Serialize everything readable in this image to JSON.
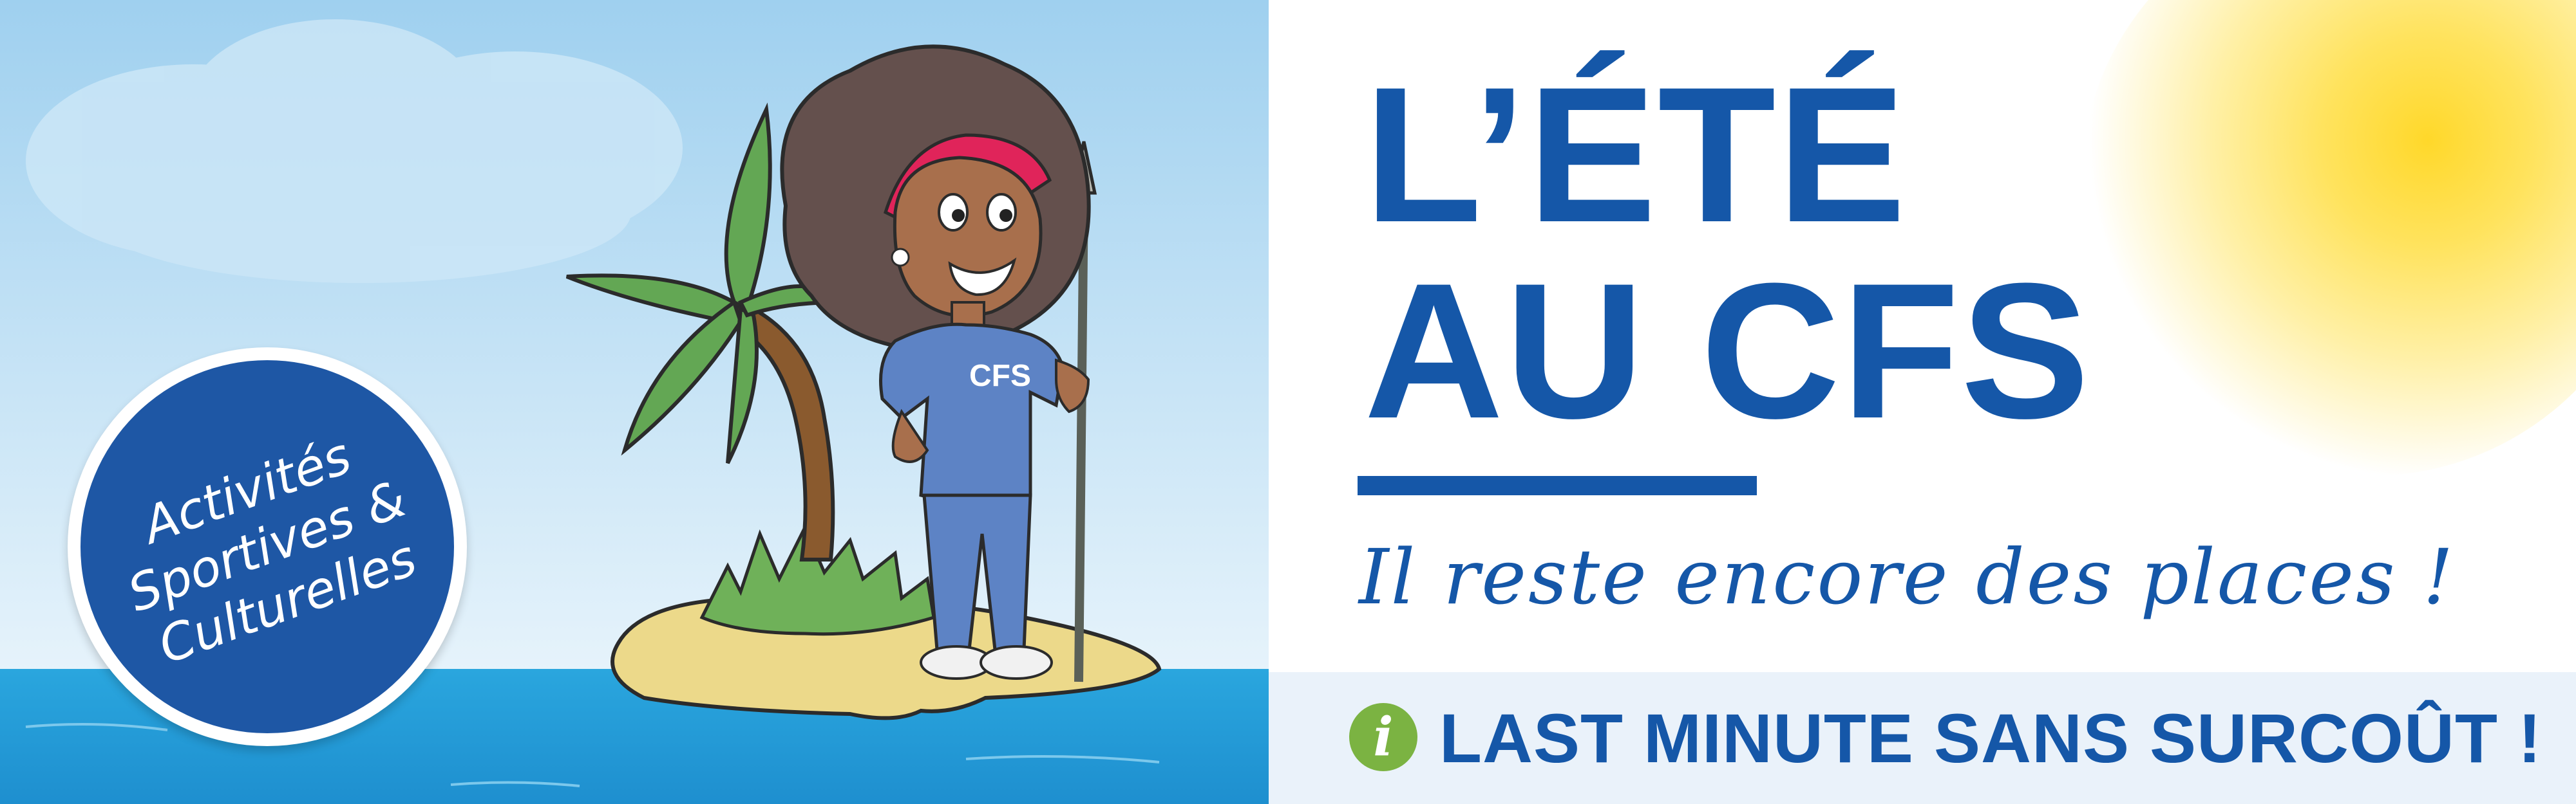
{
  "banner": {
    "title_line1": "L’ÉTÉ",
    "title_line2": "AU CFS",
    "subtitle": "Il reste encore des places !",
    "info_icon": "i",
    "last_minute": "LAST MINUTE SANS SURCOÛT !",
    "badge": {
      "line1": "Activités",
      "line2": "Sportives &",
      "line3": "Culturelles"
    },
    "shirt_logo": "CFS"
  },
  "colors": {
    "brand_blue": "#1557a8",
    "badge_blue": "#1e57a5",
    "info_green": "#7bb342",
    "sky": "#b4dbf2",
    "sea": "#29a3dc",
    "sun": "#ffd82a"
  }
}
